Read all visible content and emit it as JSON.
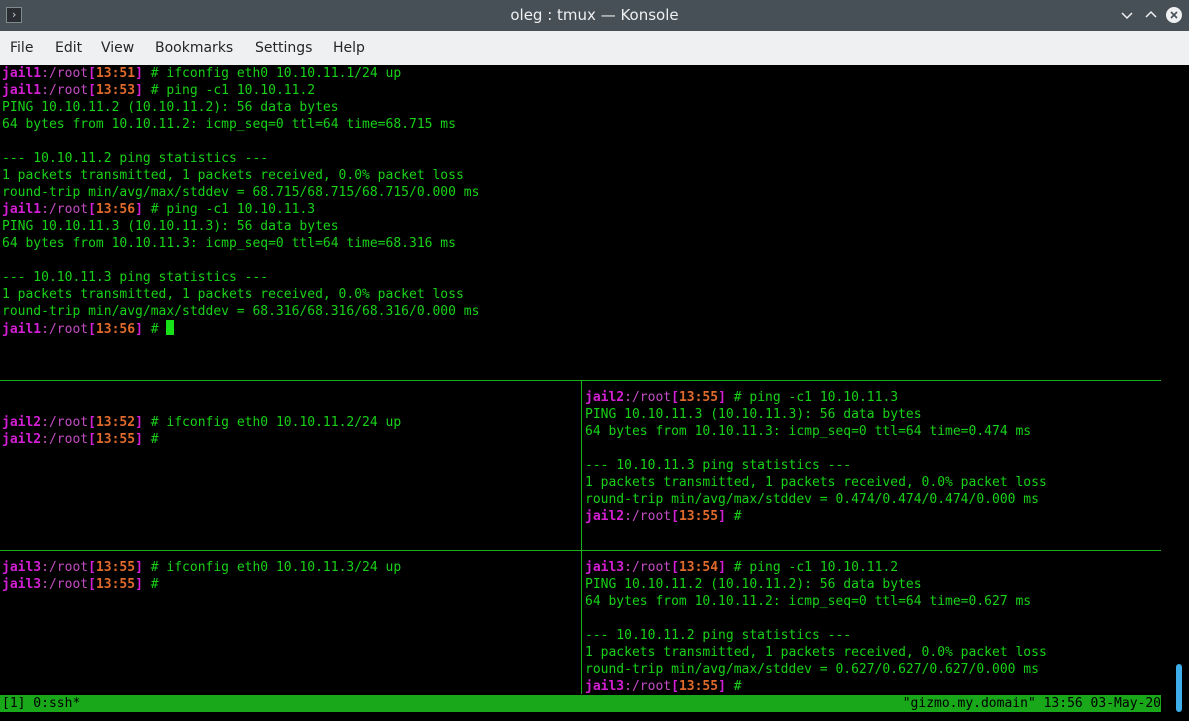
{
  "window": {
    "title": "oleg : tmux — Konsole"
  },
  "menubar": {
    "items": [
      "File",
      "Edit",
      "View",
      "Bookmarks",
      "Settings",
      "Help"
    ]
  },
  "pane1": {
    "lines": [
      {
        "host": "jail1",
        "path": ":/root",
        "time": "13:51",
        "cmd": " # ifconfig eth0 10.10.11.1/24 up"
      },
      {
        "host": "jail1",
        "path": ":/root",
        "time": "13:53",
        "cmd": " # ping -c1 10.10.11.2"
      },
      {
        "text": "PING 10.10.11.2 (10.10.11.2): 56 data bytes"
      },
      {
        "text": "64 bytes from 10.10.11.2: icmp_seq=0 ttl=64 time=68.715 ms"
      },
      {
        "text": ""
      },
      {
        "text": "--- 10.10.11.2 ping statistics ---"
      },
      {
        "text": "1 packets transmitted, 1 packets received, 0.0% packet loss"
      },
      {
        "text": "round-trip min/avg/max/stddev = 68.715/68.715/68.715/0.000 ms"
      },
      {
        "host": "jail1",
        "path": ":/root",
        "time": "13:56",
        "cmd": " # ping -c1 10.10.11.3"
      },
      {
        "text": "PING 10.10.11.3 (10.10.11.3): 56 data bytes"
      },
      {
        "text": "64 bytes from 10.10.11.3: icmp_seq=0 ttl=64 time=68.316 ms"
      },
      {
        "text": ""
      },
      {
        "text": "--- 10.10.11.3 ping statistics ---"
      },
      {
        "text": "1 packets transmitted, 1 packets received, 0.0% packet loss"
      },
      {
        "text": "round-trip min/avg/max/stddev = 68.316/68.316/68.316/0.000 ms"
      },
      {
        "host": "jail1",
        "path": ":/root",
        "time": "13:56",
        "cmd": " # ",
        "cursor": true
      }
    ]
  },
  "pane2": {
    "lines": [
      {
        "text": ""
      },
      {
        "host": "jail2",
        "path": ":/root",
        "time": "13:52",
        "cmd": " # ifconfig eth0 10.10.11.2/24 up"
      },
      {
        "host": "jail2",
        "path": ":/root",
        "time": "13:55",
        "cmd": " #"
      }
    ]
  },
  "pane3": {
    "lines": [
      {
        "host": "jail2",
        "path": ":/root",
        "time": "13:55",
        "cmd": " # ping -c1 10.10.11.3"
      },
      {
        "text": "PING 10.10.11.3 (10.10.11.3): 56 data bytes"
      },
      {
        "text": "64 bytes from 10.10.11.3: icmp_seq=0 ttl=64 time=0.474 ms"
      },
      {
        "text": ""
      },
      {
        "text": "--- 10.10.11.3 ping statistics ---"
      },
      {
        "text": "1 packets transmitted, 1 packets received, 0.0% packet loss"
      },
      {
        "text": "round-trip min/avg/max/stddev = 0.474/0.474/0.474/0.000 ms"
      },
      {
        "host": "jail2",
        "path": ":/root",
        "time": "13:55",
        "cmd": " #"
      }
    ]
  },
  "pane4": {
    "lines": [
      {
        "host": "jail3",
        "path": ":/root",
        "time": "13:55",
        "cmd": " # ifconfig eth0 10.10.11.3/24 up"
      },
      {
        "host": "jail3",
        "path": ":/root",
        "time": "13:55",
        "cmd": " #"
      }
    ]
  },
  "pane5": {
    "lines": [
      {
        "host": "jail3",
        "path": ":/root",
        "time": "13:54",
        "cmd": " # ping -c1 10.10.11.2"
      },
      {
        "text": "PING 10.10.11.2 (10.10.11.2): 56 data bytes"
      },
      {
        "text": "64 bytes from 10.10.11.2: icmp_seq=0 ttl=64 time=0.627 ms"
      },
      {
        "text": ""
      },
      {
        "text": "--- 10.10.11.2 ping statistics ---"
      },
      {
        "text": "1 packets transmitted, 1 packets received, 0.0% packet loss"
      },
      {
        "text": "round-trip min/avg/max/stddev = 0.627/0.627/0.627/0.000 ms"
      },
      {
        "host": "jail3",
        "path": ":/root",
        "time": "13:55",
        "cmd": " #"
      }
    ]
  },
  "statusbar": {
    "left": "[1] 0:ssh*",
    "right": "\"gizmo.my.domain\" 13:56 03-May-20"
  },
  "colors": {
    "text": "#18d218",
    "host": "#d41fd4",
    "time": "#e06a2c",
    "status_bg": "#19a819",
    "titlebar": "#475057"
  },
  "icons": {
    "app": "terminal-icon",
    "minimize": "chevron-down-icon",
    "maximize": "chevron-up-icon",
    "close": "close-icon"
  }
}
